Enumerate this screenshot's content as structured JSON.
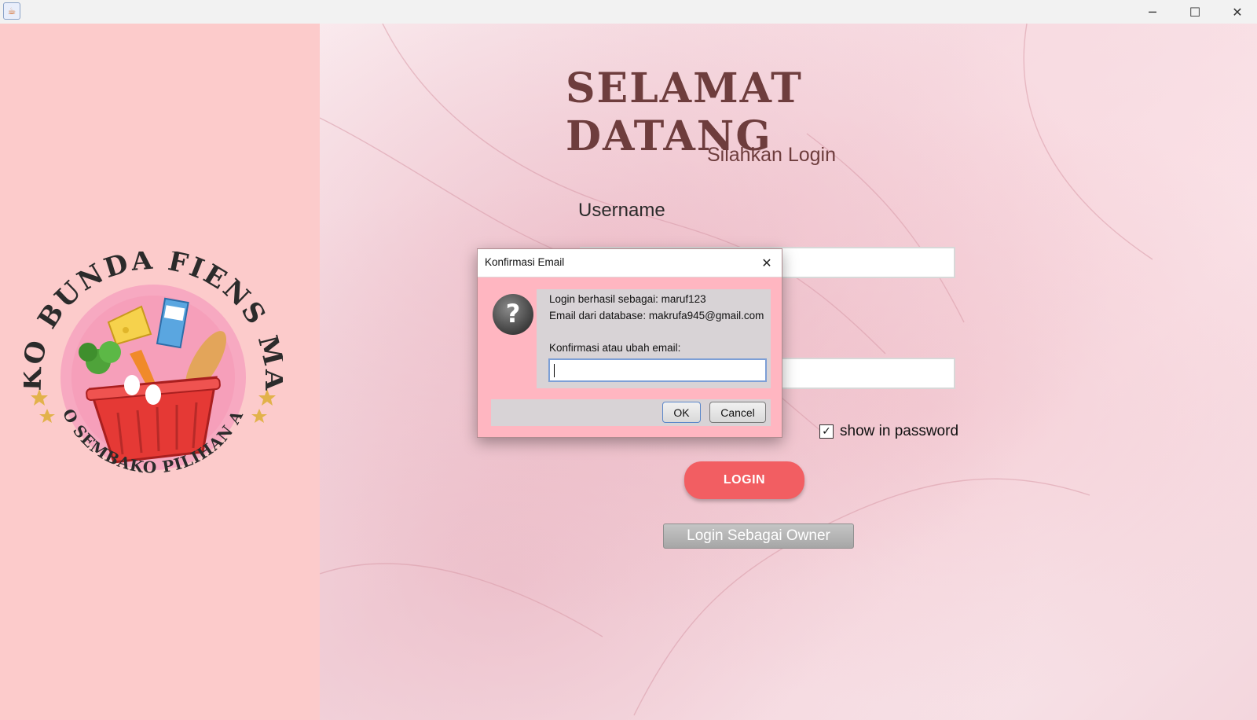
{
  "window": {
    "app_icon": "java-cup-icon",
    "controls": {
      "minimize": "─",
      "maximize": "☐",
      "close": "✕"
    }
  },
  "logo": {
    "top_text": "TOKO BUNDA FIENS MART",
    "bottom_text": "TOKO SEMBAKO PILIHAN ANDA",
    "colors": {
      "ring": "#f7a9c1",
      "basket": "#e53935",
      "stars": "#e2b24a",
      "text": "#2b2b2b"
    }
  },
  "login_form": {
    "heading": "SELAMAT DATANG",
    "subtitle": "Silahkan Login",
    "username_label": "Username",
    "username_value": "",
    "password_value": "",
    "show_password": {
      "label": "show in password",
      "checked": true,
      "check_mark": "✓"
    },
    "login_button": "LOGIN",
    "owner_button": "Login Sebagai Owner",
    "colors": {
      "heading": "#6e3d3d",
      "login_button": "#f25e62",
      "left_panel": "#fccbcb"
    }
  },
  "dialog": {
    "title": "Konfirmasi Email",
    "close_glyph": "✕",
    "icon": "question-icon",
    "message_line1": "Login berhasil sebagai: maruf123",
    "message_line2": "Email dari database: makrufa945@gmail.com",
    "prompt": "Konfirmasi atau ubah email:",
    "input_value": "",
    "ok_button": "OK",
    "cancel_button": "Cancel",
    "colors": {
      "background": "#ffb6c1",
      "panel": "#d8d3d6",
      "input_border": "#7d9fd6"
    }
  }
}
